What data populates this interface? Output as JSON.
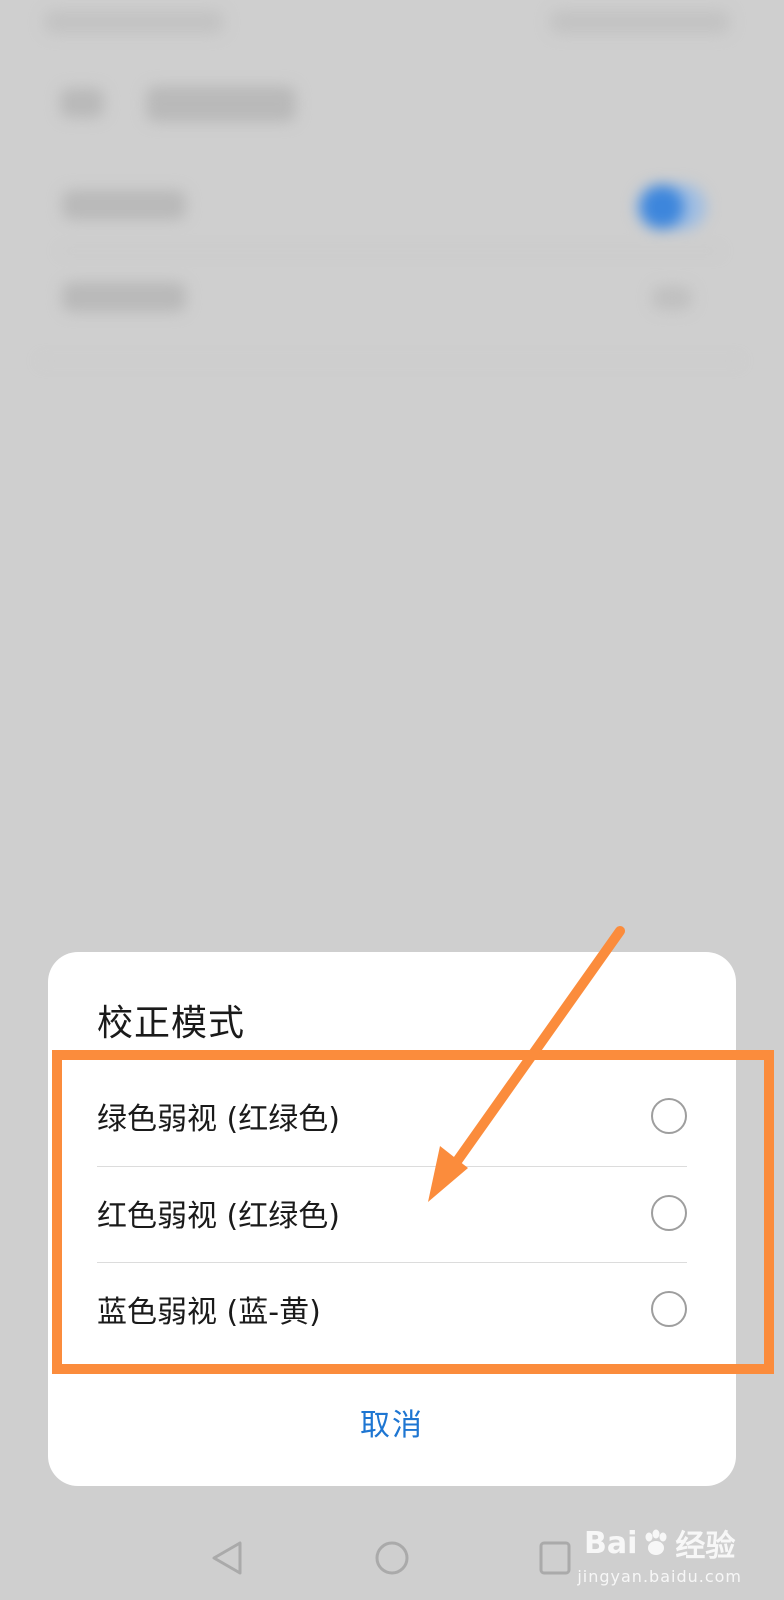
{
  "dialog": {
    "title": "校正模式",
    "options": [
      {
        "label": "绿色弱视 (红绿色)",
        "selected": false
      },
      {
        "label": "红色弱视 (红绿色)",
        "selected": false
      },
      {
        "label": "蓝色弱视 (蓝-黄)",
        "selected": false
      }
    ],
    "cancel_label": "取消"
  },
  "colors": {
    "accent": "#1e76d2",
    "annotation": "#fb8c3c",
    "toggle_on": "#3d86dc",
    "scrim": "#cfcfcf"
  },
  "watermark": {
    "brand": "Bai",
    "brand_suffix": "经验",
    "url": "jingyan.baidu.com"
  },
  "icons": {
    "nav_back": "triangle-back-icon",
    "nav_home": "circle-home-icon",
    "nav_recent": "square-recent-icon",
    "annotation_arrow": "arrow-icon"
  }
}
